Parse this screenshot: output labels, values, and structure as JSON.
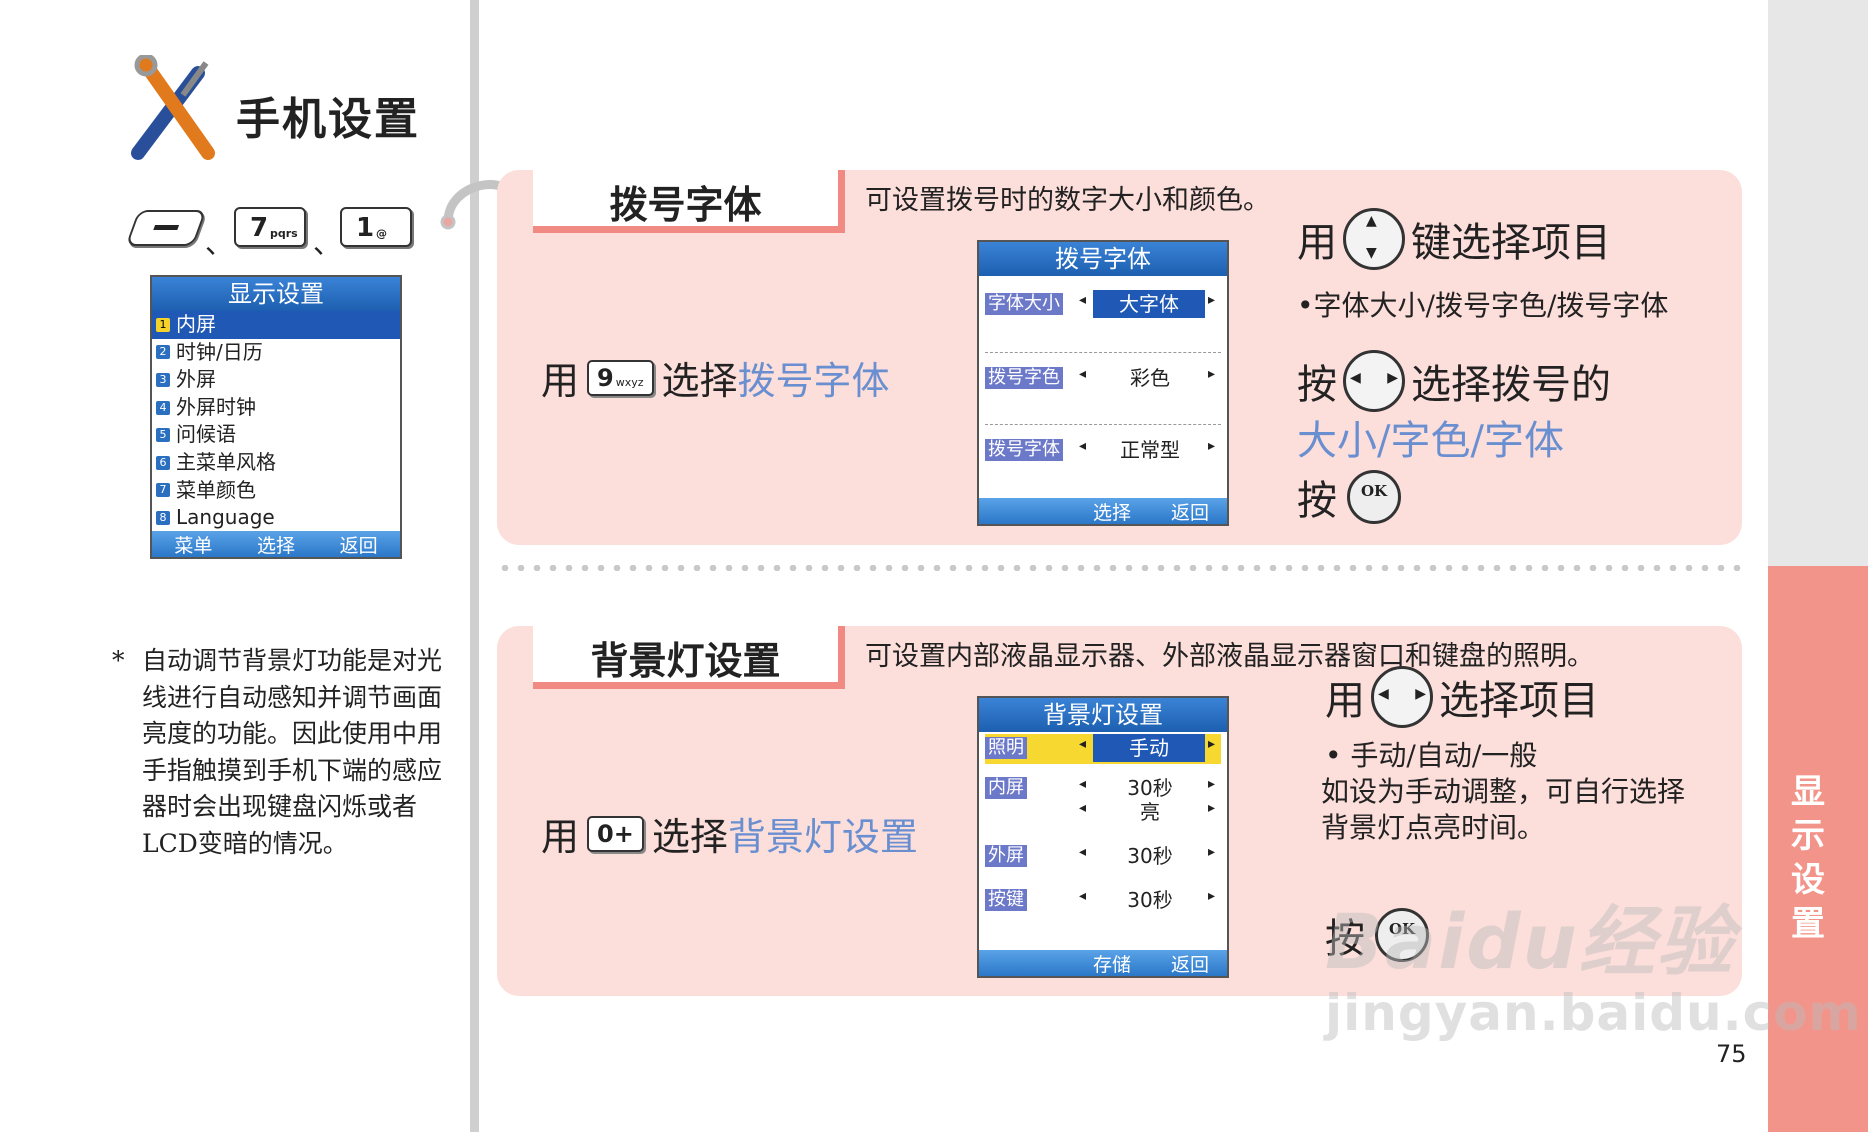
{
  "page": {
    "title": "手机设置",
    "side_label": "显示设置",
    "page_number": "75"
  },
  "shortcut": {
    "keys": [
      {
        "label": "—",
        "icon": "left-softkey-icon"
      },
      {
        "label": "7",
        "sub": "pqrs"
      },
      {
        "label": "1",
        "sub": "@"
      }
    ],
    "separator": "、"
  },
  "menu_screen": {
    "title": "显示设置",
    "items": [
      {
        "num": "1",
        "label": "内屏"
      },
      {
        "num": "2",
        "label": "时钟/日历"
      },
      {
        "num": "3",
        "label": "外屏"
      },
      {
        "num": "4",
        "label": "外屏时钟"
      },
      {
        "num": "5",
        "label": "问候语"
      },
      {
        "num": "6",
        "label": "主菜单风格"
      },
      {
        "num": "7",
        "label": "菜单颜色"
      },
      {
        "num": "8",
        "label": "Language"
      }
    ],
    "softkeys": [
      "菜单",
      "选择",
      "返回"
    ]
  },
  "note": {
    "marker": "*",
    "text": "自动调节背景灯功能是对光线进行自动感知并调节画面亮度的功能。因此使用中用手指触摸到手机下端的感应器时会出现键盘闪烁或者LCD变暗的情况。"
  },
  "section1": {
    "tab": "拨号字体",
    "description": "可设置拨号时的数字大小和颜色。",
    "use_prefix": "用",
    "use_key": "9",
    "use_key_sub": "wxyz",
    "use_verb": "选择",
    "use_target": "拨号字体",
    "screen": {
      "title": "拨号字体",
      "rows": [
        {
          "label": "字体大小",
          "value": "大字体"
        },
        {
          "label": "拨号字色",
          "value": "彩色"
        },
        {
          "label": "拨号字体",
          "value": "正常型"
        }
      ],
      "softkeys": [
        "选择",
        "返回"
      ]
    },
    "instructions": {
      "step1_pre": "用",
      "step1_post": "键选择项目",
      "bullet": "•字体大小/拨号字色/拨号字体",
      "step2_pre": "按",
      "step2_post": "选择拨号的",
      "step2_target": "大小/字色/字体",
      "step3_pre": "按",
      "ok": "OK"
    }
  },
  "section2": {
    "tab": "背景灯设置",
    "description": "可设置内部液晶显示器、外部液晶显示器窗口和键盘的照明。",
    "use_prefix": "用",
    "use_key": "0+",
    "use_verb": "选择",
    "use_target": "背景灯设置",
    "screen": {
      "title": "背景灯设置",
      "rows": [
        {
          "label": "照明",
          "value": "手动"
        },
        {
          "label": "内屏",
          "value": "30秒",
          "value2": "亮"
        },
        {
          "label": "外屏",
          "value": "30秒"
        },
        {
          "label": "按键",
          "value": "30秒"
        }
      ],
      "softkeys": [
        "存储",
        "返回"
      ]
    },
    "instructions": {
      "step1_pre": "用",
      "step1_post": "选择项目",
      "bullet": "• 手动/自动/一般",
      "detail": "如设为手动调整，可自行选择背景灯点亮时间。",
      "step2_pre": "按",
      "ok": "OK"
    }
  },
  "watermark": {
    "brand": "Baidu经验",
    "url": "jingyan.baidu.com"
  },
  "colors": {
    "section_bg": "#fcdedb",
    "accent": "#f08a82",
    "strip_tab": "#f3948a",
    "link_blue": "#6a8fd0",
    "lcd_blue": "#1f58b5"
  }
}
